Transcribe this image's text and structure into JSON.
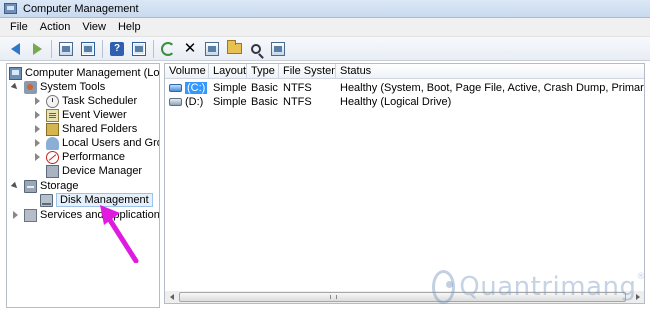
{
  "window": {
    "title": "Computer Management"
  },
  "menu": [
    "File",
    "Action",
    "View",
    "Help"
  ],
  "tree": {
    "root": "Computer Management (Local",
    "system_tools": "System Tools",
    "task_scheduler": "Task Scheduler",
    "event_viewer": "Event Viewer",
    "shared_folders": "Shared Folders",
    "local_users": "Local Users and Groups",
    "performance": "Performance",
    "device_manager": "Device Manager",
    "storage": "Storage",
    "disk_management": "Disk Management",
    "services": "Services and Applications"
  },
  "list": {
    "columns": [
      "Volume",
      "Layout",
      "Type",
      "File System",
      "Status"
    ],
    "rows": [
      {
        "volume": "(C:)",
        "layout": "Simple",
        "type": "Basic",
        "fs": "NTFS",
        "status": "Healthy (System, Boot, Page File, Active, Crash Dump, Primary Partition)"
      },
      {
        "volume": "(D:)",
        "layout": "Simple",
        "type": "Basic",
        "fs": "NTFS",
        "status": "Healthy (Logical Drive)"
      }
    ]
  },
  "watermark": {
    "text": "Quantrimang",
    "mark": "®"
  },
  "colors": {
    "selection": "#3399ff",
    "annotation_arrow": "#e01be0"
  }
}
